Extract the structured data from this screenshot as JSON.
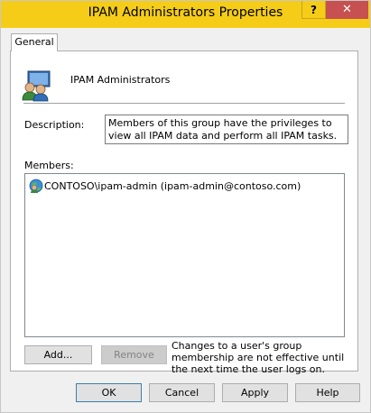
{
  "window": {
    "title": "IPAM Administrators Properties",
    "help_glyph": "?",
    "close_glyph": "✕"
  },
  "tabs": [
    {
      "label": "General"
    }
  ],
  "general": {
    "group_name": "IPAM Administrators",
    "description_label": "Description:",
    "description_value": "Members of this group have the privileges to view all IPAM data and perform all IPAM tasks.",
    "members_label": "Members:",
    "members": [
      {
        "name": "CONTOSO\\ipam-admin (ipam-admin@contoso.com)",
        "icon": "user-icon"
      }
    ],
    "add_label": "Add...",
    "remove_label": "Remove",
    "note": "Changes to a user's group membership are not effective until the next time the user logs on."
  },
  "footer": {
    "ok_label": "OK",
    "cancel_label": "Cancel",
    "apply_label": "Apply",
    "help_label": "Help"
  },
  "colors": {
    "titlebar": "#f5cd19",
    "close_button": "#c75050",
    "dialog_bg": "#f0f0f0"
  }
}
